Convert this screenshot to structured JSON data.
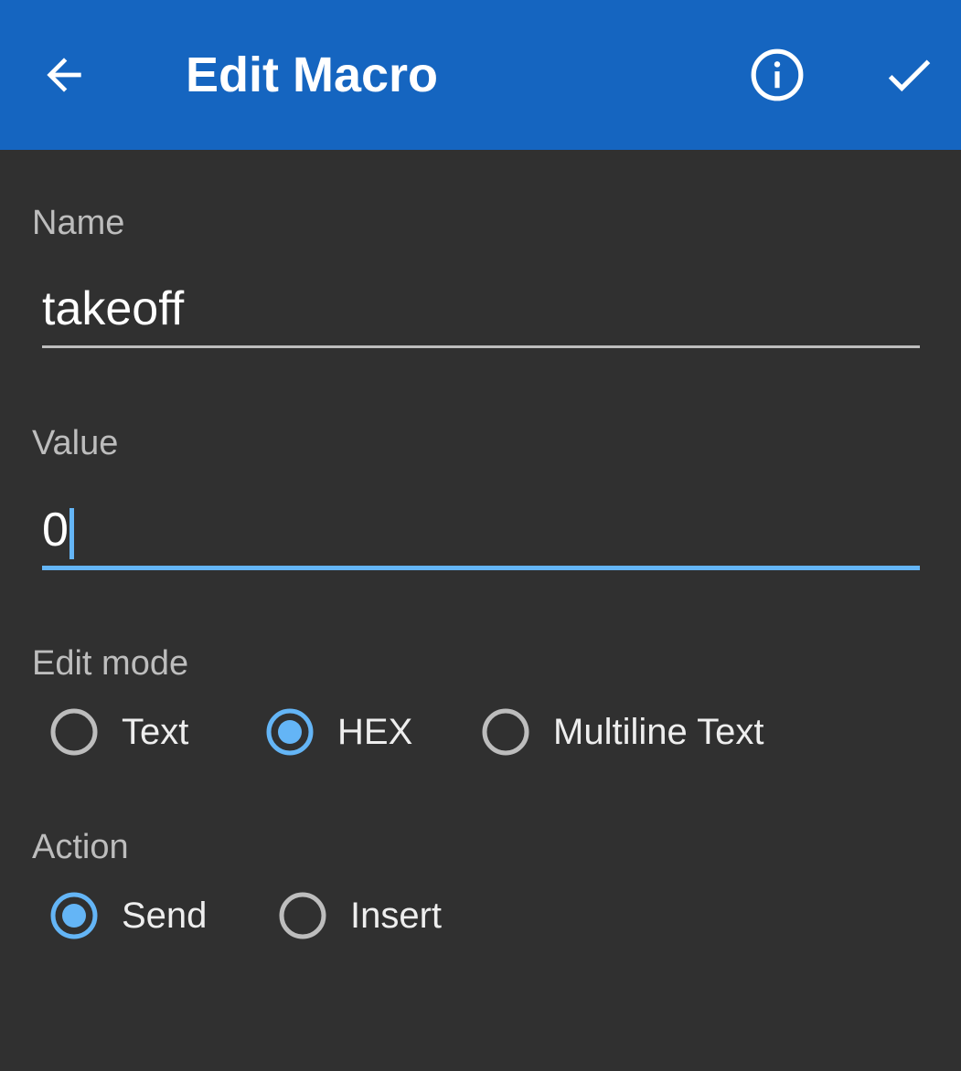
{
  "appbar": {
    "title": "Edit Macro",
    "back_icon": "arrow-back-icon",
    "info_icon": "info-icon",
    "done_icon": "checkmark-icon",
    "background_color": "#1565c0"
  },
  "form": {
    "name": {
      "label": "Name",
      "value": "takeoff"
    },
    "value": {
      "label": "Value",
      "value": "0"
    },
    "edit_mode": {
      "label": "Edit mode",
      "options": [
        {
          "label": "Text",
          "selected": false
        },
        {
          "label": "HEX",
          "selected": true
        },
        {
          "label": "Multiline Text",
          "selected": false
        }
      ]
    },
    "action": {
      "label": "Action",
      "options": [
        {
          "label": "Send",
          "selected": true
        },
        {
          "label": "Insert",
          "selected": false
        }
      ]
    }
  },
  "colors": {
    "accent": "#64b5f6",
    "background": "#303030",
    "label": "#bdbdbd"
  }
}
